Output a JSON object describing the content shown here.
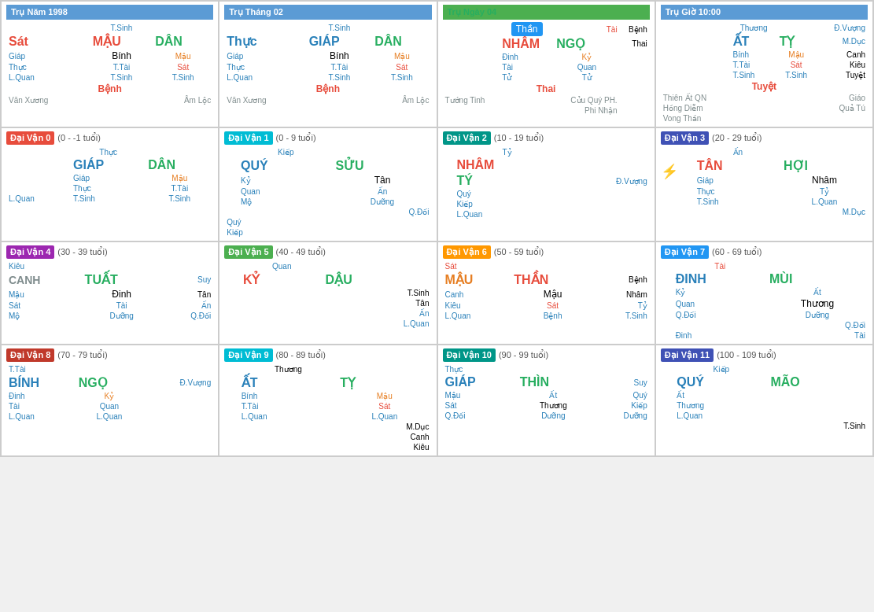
{
  "colors": {
    "red": "#e74c3c",
    "blue": "#2196f3",
    "green": "#27ae60",
    "orange": "#e67e22",
    "purple": "#8e44ad",
    "gray": "#7f8c8d",
    "cyan": "#00bcd4",
    "dark": "#2c3e50"
  },
  "sections": {
    "tru_nam": "Trụ Năm 1998",
    "tru_thang": "Trụ Tháng 02",
    "tru_ngay": "Trụ Ngày 04",
    "tru_gio": "Trụ Giờ 10:00"
  },
  "dai_van_labels": [
    "Đại Vận 0",
    "Đại Vận 1",
    "Đại Vận 2",
    "Đại Vận 3",
    "Đại Vận 4",
    "Đại Vận 5",
    "Đại Vận 6",
    "Đại Vận 7",
    "Đại Vận 8",
    "Đại Vận 9",
    "Đại Vận 10",
    "Đại Vận 11"
  ],
  "dai_van_ages": [
    "(0 - -1 tuổi)",
    "(0 - 9 tuổi)",
    "(10 - 19 tuổi)",
    "(20 - 29 tuổi)",
    "(30 - 39 tuổi)",
    "(40 - 49 tuổi)",
    "(50 - 59 tuổi)",
    "(60 - 69 tuổi)",
    "(70 - 79 tuổi)",
    "(80 - 89 tuổi)",
    "(90 - 99 tuổi)",
    "(100 - 109 tuổi)"
  ]
}
